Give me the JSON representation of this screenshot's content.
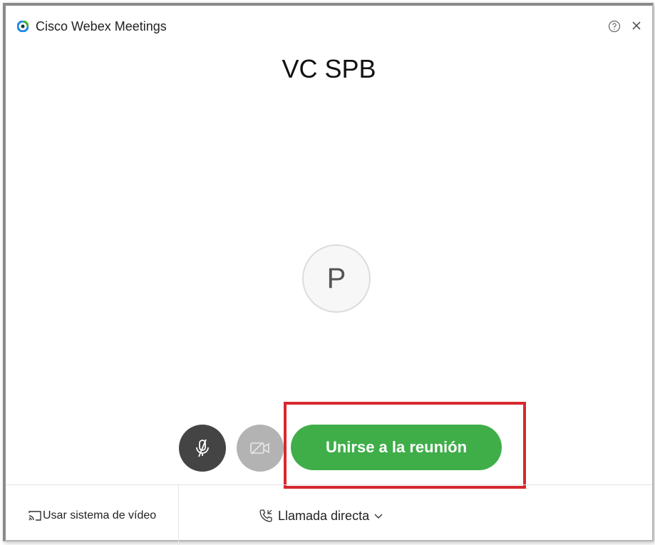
{
  "window": {
    "app_title": "Cisco Webex Meetings"
  },
  "meeting": {
    "title": "VC SPB",
    "avatar_initial": "P"
  },
  "controls": {
    "join_label": "Unirse a la reunión"
  },
  "footer": {
    "video_system_label": "Usar sistema de vídeo",
    "direct_call_label": "Llamada directa"
  },
  "colors": {
    "join_button": "#3fae49",
    "mic_button": "#444444",
    "camera_button": "#b3b3b3",
    "highlight_border": "#d7282f"
  },
  "icons": {
    "logo": "webex-logo-icon",
    "help": "help-icon",
    "close": "close-icon",
    "mic": "microphone-muted-icon",
    "camera": "camera-off-icon",
    "video_system": "cast-icon",
    "direct_call": "phone-icon",
    "dropdown": "chevron-down-icon"
  }
}
